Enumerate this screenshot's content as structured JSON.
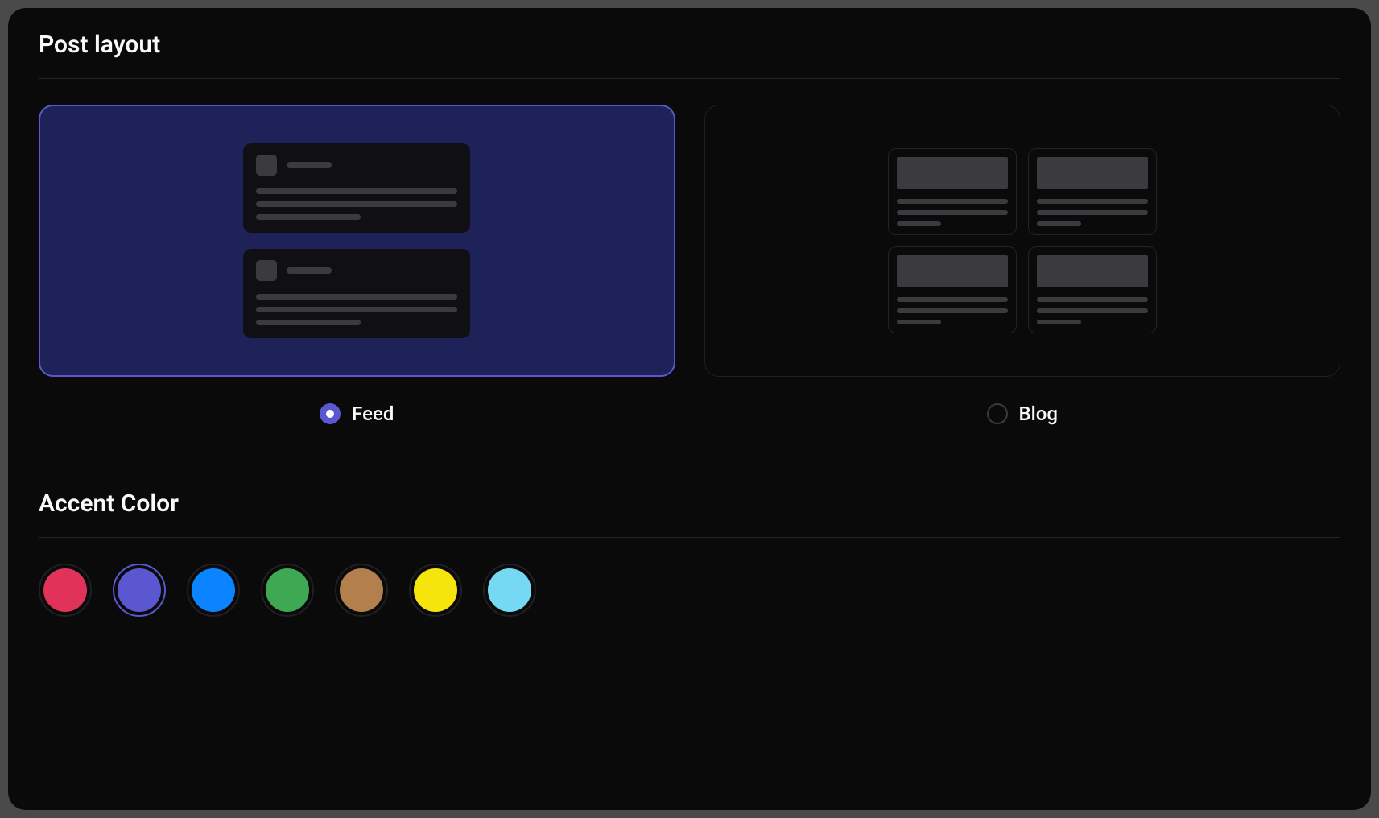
{
  "postLayout": {
    "title": "Post layout",
    "selected": "feed",
    "options": {
      "feed": {
        "label": "Feed"
      },
      "blog": {
        "label": "Blog"
      }
    }
  },
  "accentColor": {
    "title": "Accent Color",
    "selected": 1,
    "colors": [
      "#e1325a",
      "#5b57d1",
      "#0a85ff",
      "#3ea853",
      "#b27f4d",
      "#f6e40d",
      "#76d9f3"
    ]
  }
}
